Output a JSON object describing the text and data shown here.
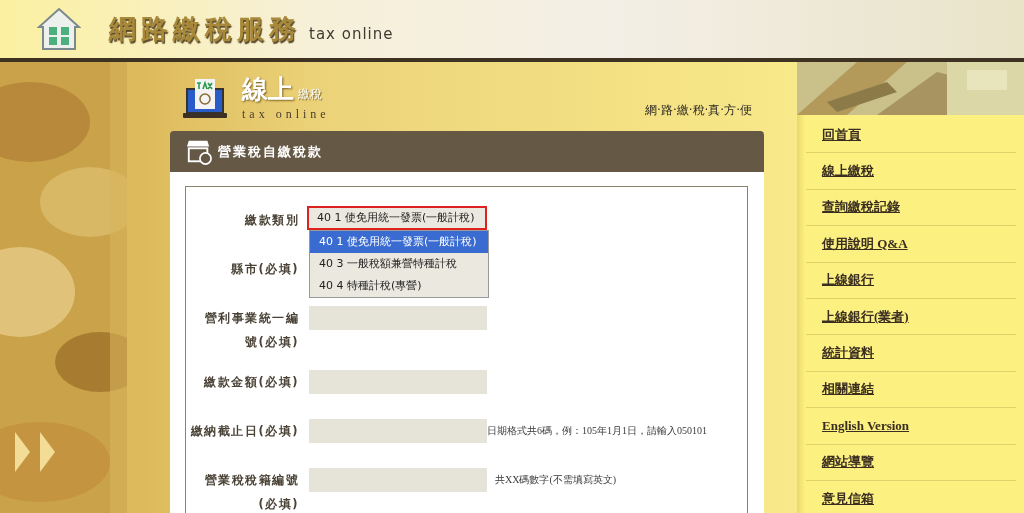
{
  "header": {
    "title": "網路繳稅服務",
    "subtitle": "tax online"
  },
  "banner": {
    "title": "線上",
    "title_small": "繳稅",
    "subtitle": "tax online",
    "tagline": "網·路·繳·稅·真·方·便"
  },
  "panel": {
    "title": "營業稅自繳稅款"
  },
  "form": {
    "fields": [
      {
        "label": "繳款類別",
        "kind": "select",
        "value": "40 1 使免用統一發票(一般計稅)",
        "focused": true,
        "options": [
          {
            "label": "40 1 使免用統一發票(一般計稅)",
            "selected": true
          },
          {
            "label": "40 3 一般稅額兼營特種計稅",
            "selected": false
          },
          {
            "label": "40 4 特種計稅(專營)",
            "selected": false
          }
        ]
      },
      {
        "label": "縣市(必填)",
        "kind": "covered"
      },
      {
        "label": "營利事業統一編號(必填)",
        "kind": "text"
      },
      {
        "label": "繳款金額(必填)",
        "kind": "text"
      },
      {
        "label": "繳納截止日(必填)",
        "kind": "text",
        "hint": "日期格式共6碼，例：105年1月1日，請輸入050101"
      },
      {
        "label": "營業稅稅籍編號(必填)",
        "kind": "text",
        "hint": "共XX碼數字(不需填寫英文)"
      }
    ]
  },
  "nav": [
    "回首頁",
    "線上繳稅",
    "查詢繳稅記錄",
    "使用說明 Q&A",
    "上線銀行",
    "上線銀行(業者)",
    "統計資料",
    "相關連結",
    "English Version",
    "網站導覽",
    "意見信箱"
  ]
}
